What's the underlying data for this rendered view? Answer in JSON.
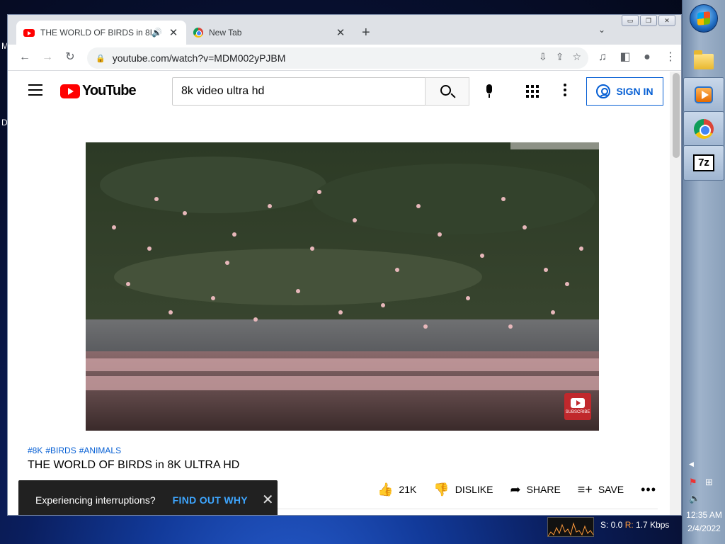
{
  "desktop": {
    "left_letter_1": "M",
    "left_letter_2": "D"
  },
  "browser": {
    "tabs": [
      {
        "title": "THE WORLD OF BIRDS in 8K",
        "active": true,
        "favicon": "youtube-icon",
        "audio": "speaker-icon"
      },
      {
        "title": "New Tab",
        "active": false,
        "favicon": "chrome-icon"
      }
    ],
    "new_tab_symbol": "+",
    "address": {
      "url": "youtube.com/watch?v=MDM002yPJBM"
    }
  },
  "youtube": {
    "logo_text": "YouTube",
    "search": {
      "value": "8k video ultra hd",
      "placeholder": "Search"
    },
    "signin_label": "SIGN IN",
    "video": {
      "hashtags": [
        "#8K",
        "#BIRDS",
        "#ANIMALS"
      ],
      "title": "THE WORLD OF BIRDS in 8K ULTRA HD",
      "watermark": "SUBSCRIBE"
    },
    "actions": {
      "likes": "21K",
      "dislike": "DISLIKE",
      "share": "SHARE",
      "save": "SAVE"
    },
    "toast": {
      "message": "Experiencing interruptions?",
      "link": "FIND OUT WHY"
    }
  },
  "taskbar": {
    "clock_time": "12:35 AM",
    "clock_date": "2/4/2022",
    "apps": [
      "windows-explorer-icon",
      "media-player-icon",
      "chrome-icon",
      "7zip-icon"
    ],
    "sevenzip_label": "7z"
  },
  "net_monitor": {
    "s_label": "S: 0.0",
    "r_label": "R:",
    "r_value": "1.7 Kbps"
  },
  "colors": {
    "youtube_red": "#ff0000",
    "link_blue": "#065fd4",
    "toast_link": "#3ea6ff"
  }
}
